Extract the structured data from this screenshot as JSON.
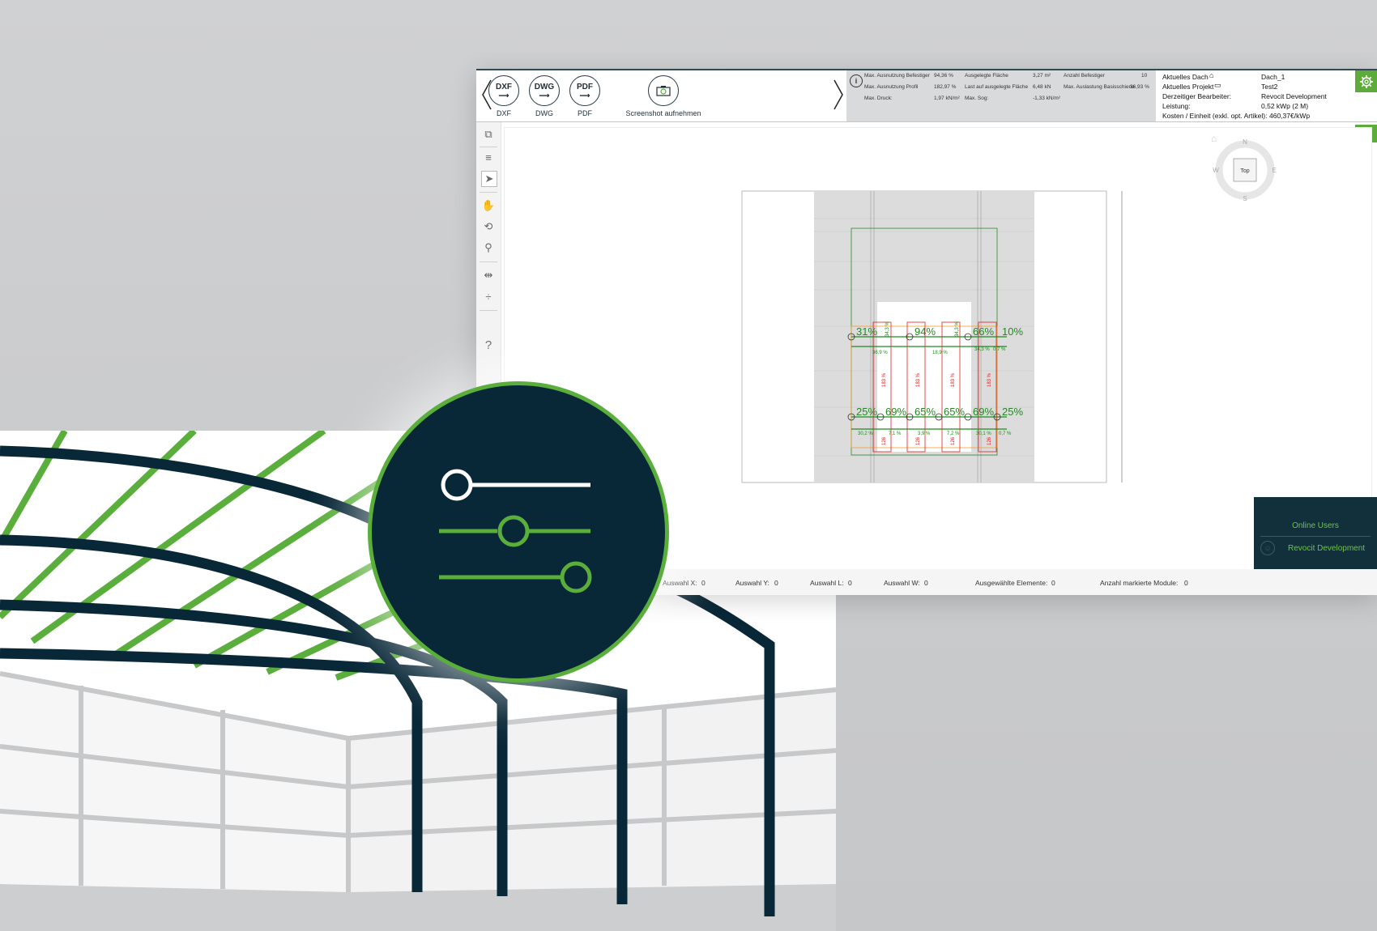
{
  "colors": {
    "brand_green": "#5aae3b",
    "dark_navy": "#082737",
    "measure_green": "#1f8a1f",
    "measure_red": "#e02020"
  },
  "toolbar": {
    "tools": [
      {
        "icon": "DXF",
        "label": "DXF"
      },
      {
        "icon": "DWG",
        "label": "DWG"
      },
      {
        "icon": "PDF",
        "label": "PDF"
      },
      {
        "icon": "camera-icon",
        "label": "Screenshot aufnehmen"
      }
    ]
  },
  "info": {
    "c1": [
      {
        "label": "Max. Ausnutzung Befestiger",
        "value": "94,36 %"
      },
      {
        "label": "Max. Ausnutzung Profil",
        "value": "182,97 %"
      },
      {
        "label": "Max. Druck:",
        "value": "1,97 kN/m²"
      }
    ],
    "c2": [
      {
        "label": "Ausgelegte Fläche",
        "value": "3,27 m²"
      },
      {
        "label": "Last auf ausgelegte Fläche",
        "value": "6,48 kN"
      },
      {
        "label": "Max. Sog:",
        "value": "-1,33 kN/m²"
      }
    ],
    "c3": [
      {
        "label": "Anzahl Befestiger",
        "value": "10"
      },
      {
        "label": "Max. Auslastung Basisschiene",
        "value": "36,93 %"
      }
    ]
  },
  "project": {
    "rows": [
      {
        "label": "Aktuelles Dach",
        "value": "Dach_1"
      },
      {
        "label": "Aktuelles Projekt",
        "value": "Test2"
      },
      {
        "label": "Derzeitiger Bearbeiter:",
        "value": "Revocit Development"
      },
      {
        "label": "Leistung:",
        "value": "0,52 kWp (2 M)"
      },
      {
        "label": "Kosten / Einheit (exkl. opt. Artikel):",
        "value": "460,37€/kWp"
      }
    ]
  },
  "compass": {
    "n": "N",
    "s": "S",
    "e": "E",
    "w": "W",
    "top": "Top"
  },
  "drawing": {
    "row1": [
      "31%",
      "94%",
      "66%",
      "10%"
    ],
    "row2": [
      "25%",
      "69%",
      "65%",
      "65%",
      "69%",
      "25%"
    ],
    "green_small": [
      "36,9 %",
      "18,9 %",
      "34,3 %",
      "0,7 %",
      "30,2 %",
      "7,1 %",
      "3,9 %",
      "7,2 %",
      "30,1 %",
      "0,7 %"
    ],
    "red_v": [
      "183 %",
      "183 %",
      "183 %",
      "183 %"
    ],
    "red_v2": [
      "126",
      "126",
      "126",
      "126"
    ],
    "green_v": [
      "34,3 %",
      "34,3 %"
    ]
  },
  "help": "?",
  "status": [
    {
      "label": "Auswahl X:",
      "value": "0"
    },
    {
      "label": "Auswahl Y:",
      "value": "0"
    },
    {
      "label": "Auswahl L:",
      "value": "0"
    },
    {
      "label": "Auswahl W:",
      "value": "0"
    },
    {
      "label": "Ausgewählte Elemente:",
      "value": "0"
    },
    {
      "label": "Anzahl markierte Module:",
      "value": "0"
    }
  ],
  "users": {
    "title": "Online Users",
    "name": "Revocit Development"
  }
}
